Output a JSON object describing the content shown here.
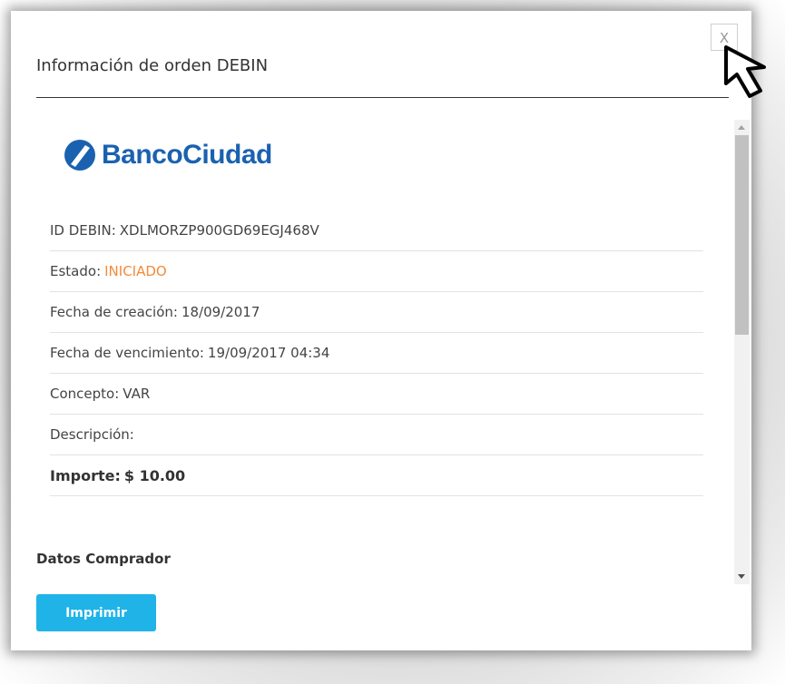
{
  "modal": {
    "title": "Información de orden DEBIN",
    "close_label": "X"
  },
  "brand": {
    "name": "BancoCiudad",
    "color": "#1a62b0"
  },
  "details": [
    {
      "label": "ID DEBIN:",
      "value": "XDLMORZP900GD69EGJ468V"
    },
    {
      "label": "Estado:",
      "value": "INICIADO",
      "value_color": "#f28a3a"
    },
    {
      "label": "Fecha de creación:",
      "value": "18/09/2017"
    },
    {
      "label": "Fecha de vencimiento:",
      "value": "19/09/2017 04:34"
    },
    {
      "label": "Concepto:",
      "value": "VAR"
    },
    {
      "label": "Descripción:",
      "value": ""
    },
    {
      "label": "Importe:",
      "value": "$ 10.00"
    }
  ],
  "section": {
    "buyer_title": "Datos Comprador"
  },
  "actions": {
    "print_label": "Imprimir",
    "print_color": "#1fb3e8"
  },
  "icons": {
    "close": "close-icon",
    "logo": "banco-ciudad-logo-icon",
    "cursor": "mouse-pointer-icon"
  }
}
